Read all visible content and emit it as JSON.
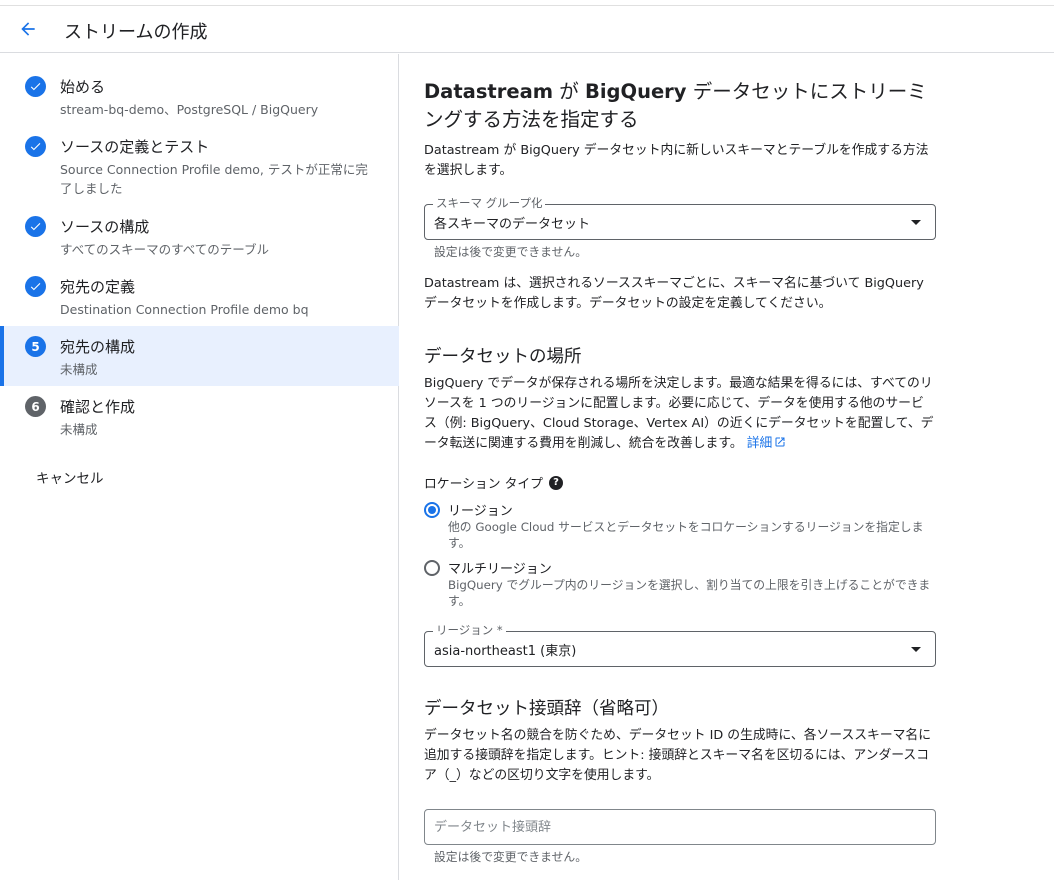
{
  "header": {
    "title": "ストリームの作成"
  },
  "sidebar": {
    "steps": [
      {
        "title": "始める",
        "subtitle": "stream-bq-demo、PostgreSQL / BigQuery",
        "status": "done"
      },
      {
        "title": "ソースの定義とテスト",
        "subtitle": "Source Connection Profile demo, テストが正常に完了しました",
        "status": "done"
      },
      {
        "title": "ソースの構成",
        "subtitle": "すべてのスキーマのすべてのテーブル",
        "status": "done"
      },
      {
        "title": "宛先の定義",
        "subtitle": "Destination Connection Profile demo bq",
        "status": "done"
      },
      {
        "title": "宛先の構成",
        "subtitle": "未構成",
        "status": "current",
        "number": "5"
      },
      {
        "title": "確認と作成",
        "subtitle": "未構成",
        "status": "pending",
        "number": "6"
      }
    ],
    "cancel_label": "キャンセル"
  },
  "main": {
    "heading_bold1": "Datastream",
    "heading_part2": " が ",
    "heading_bold3": "BigQuery",
    "heading_part4": " データセットにストリーミングする方法を指定する",
    "heading_desc": "Datastream が BigQuery データセット内に新しいスキーマとテーブルを作成する方法を選択します。",
    "schema_group": {
      "label": "スキーマ グループ化",
      "value": "各スキーマのデータセット",
      "hint": "設定は後で変更できません。"
    },
    "schema_desc": "Datastream は、選択されるソーススキーマごとに、スキーマ名に基づいて BigQuery データセットを作成します。データセットの設定を定義してください。",
    "location": {
      "heading": "データセットの場所",
      "desc": "BigQuery でデータが保存される場所を決定します。最適な結果を得るには、すべてのリソースを 1 つのリージョンに配置します。必要に応じて、データを使用する他のサービス（例: BigQuery、Cloud Storage、Vertex AI）の近くにデータセットを配置して、データ転送に関連する費用を削減し、統合を改善します。",
      "link": "詳細",
      "type_label": "ロケーション タイプ",
      "options": [
        {
          "label": "リージョン",
          "desc": "他の Google Cloud サービスとデータセットをコロケーションするリージョンを指定します。",
          "checked": true
        },
        {
          "label": "マルチリージョン",
          "desc": "BigQuery でグループ内のリージョンを選択し、割り当ての上限を引き上げることができます。",
          "checked": false
        }
      ],
      "region_label": "リージョン *",
      "region_value": "asia-northeast1 (東京)"
    },
    "prefix": {
      "heading": "データセット接頭辞（省略可）",
      "desc": "データセット名の競合を防ぐため、データセット ID の生成時に、各ソーススキーマ名に追加する接頭辞を指定します。ヒント: 接頭辞とスキーマ名を区切るには、アンダースコア（_）などの区切り文字を使用します。",
      "placeholder": "データセット接頭辞",
      "hint": "設定は後で変更できません。"
    }
  },
  "colors": {
    "accent": "#1a73e8",
    "text": "#202124",
    "muted": "#5f6368",
    "active_bg": "#e8f0fe"
  }
}
